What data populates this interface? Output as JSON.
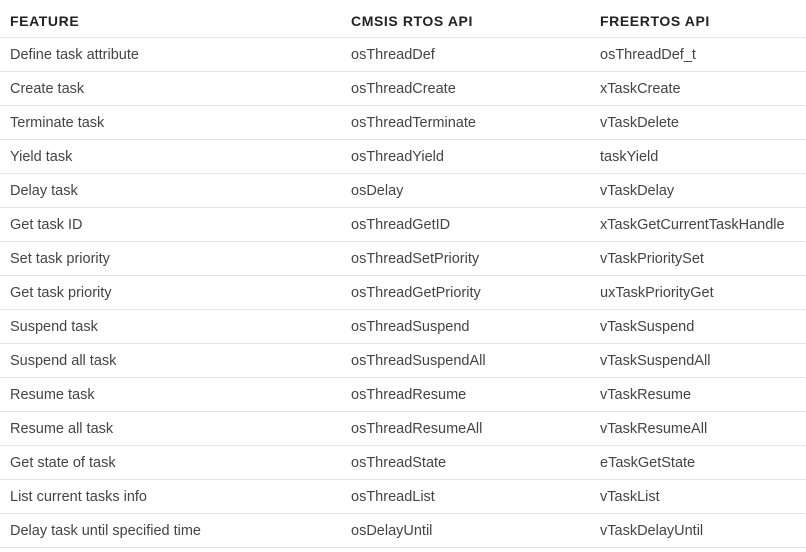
{
  "table": {
    "headers": [
      "FEATURE",
      "CMSIS RTOS API",
      "FREERTOS API"
    ],
    "rows": [
      [
        "Define task attribute",
        "osThreadDef",
        "osThreadDef_t"
      ],
      [
        "Create task",
        "osThreadCreate",
        "xTaskCreate"
      ],
      [
        "Terminate task",
        "osThreadTerminate",
        "vTaskDelete"
      ],
      [
        "Yield task",
        "osThreadYield",
        "taskYield"
      ],
      [
        "Delay task",
        "osDelay",
        "vTaskDelay"
      ],
      [
        "Get task ID",
        "osThreadGetID",
        "xTaskGetCurrentTaskHandle"
      ],
      [
        "Set task priority",
        "osThreadSetPriority",
        "vTaskPrioritySet"
      ],
      [
        "Get task priority",
        "osThreadGetPriority",
        "uxTaskPriorityGet"
      ],
      [
        "Suspend task",
        "osThreadSuspend",
        "vTaskSuspend"
      ],
      [
        "Suspend all task",
        "osThreadSuspendAll",
        "vTaskSuspendAll"
      ],
      [
        "Resume task",
        "osThreadResume",
        "vTaskResume"
      ],
      [
        "Resume all task",
        "osThreadResumeAll",
        "vTaskResumeAll"
      ],
      [
        "Get state of task",
        "osThreadState",
        "eTaskGetState"
      ],
      [
        "List current tasks info",
        "osThreadList",
        "vTaskList"
      ],
      [
        "Delay task until specified time",
        "osDelayUntil",
        "vTaskDelayUntil"
      ]
    ]
  }
}
